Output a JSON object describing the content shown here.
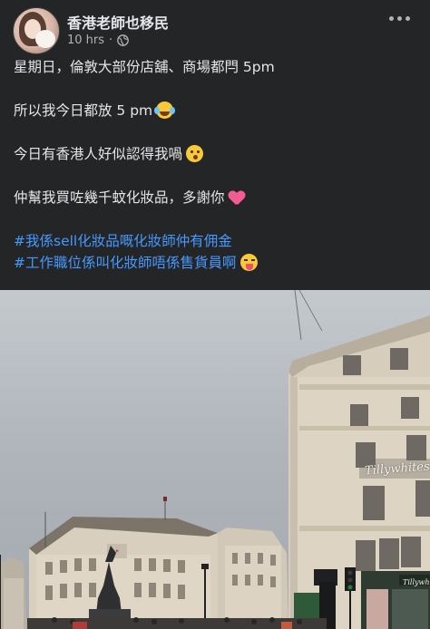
{
  "post": {
    "page_name": "香港老師也移民",
    "timestamp": "10 hrs",
    "separator": "·",
    "audience_icon": "globe-icon",
    "more_icon": "more-horizontal-icon"
  },
  "body": {
    "line1": "星期日，倫敦大部份店舖、商場都閂 5pm",
    "line2": "所以我今日都放 5 pm",
    "line2_emoji": "face-with-tears-of-joy",
    "line3": "今日有香港人好似認得我喎",
    "line3_emoji": "hushed-face",
    "line4": "仲幫我買咗幾千蚊化妝品，多謝你",
    "line4_emoji": "sparkling-heart",
    "hashtag1": "#我係sell化妝品嘅化妝師仲有佣金",
    "hashtag2": "#工作職位係叫化妝師唔係售貨員啊",
    "hashtag2_emoji": "squinting-face-with-tongue"
  },
  "photo": {
    "sign_text": "Tillywhites",
    "sign_small_text": "Tillywhites"
  },
  "colors": {
    "background": "#242526",
    "text": "#e4e6eb",
    "secondary_text": "#b0b3b8",
    "hashtag": "#4599ff"
  }
}
